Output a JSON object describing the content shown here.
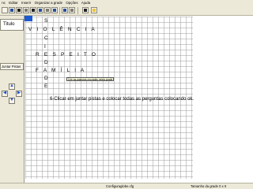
{
  "menu": [
    "nc",
    "Editar",
    "Inserir",
    "Organizar a grade",
    "Opções",
    "Ajuda"
  ],
  "sidebar": {
    "title_label": "Titulo",
    "join_button": "Juntar Pistas",
    "arrows": {
      "up": "▲",
      "down": "▼",
      "left": "◀",
      "right": "▶"
    }
  },
  "grid": {
    "rows": [
      "S",
      "V I O L Ê N C I A",
      "C",
      "I",
      "R E S P E I T O",
      "D",
      "F A M Í L I A",
      "D",
      "E"
    ]
  },
  "tooltip": "Crie as palavras cruzadas nesta grade",
  "instruction": "6-Clicar em juntar pistas e colocar todas as perguntas colocando ok.",
  "status": {
    "file": "Configuraglobe.cfg",
    "grid_size": "Tamanho da grade 0 x 0"
  },
  "colors": {
    "accent": "#1c5ad2",
    "chrome": "#ece9d8"
  }
}
